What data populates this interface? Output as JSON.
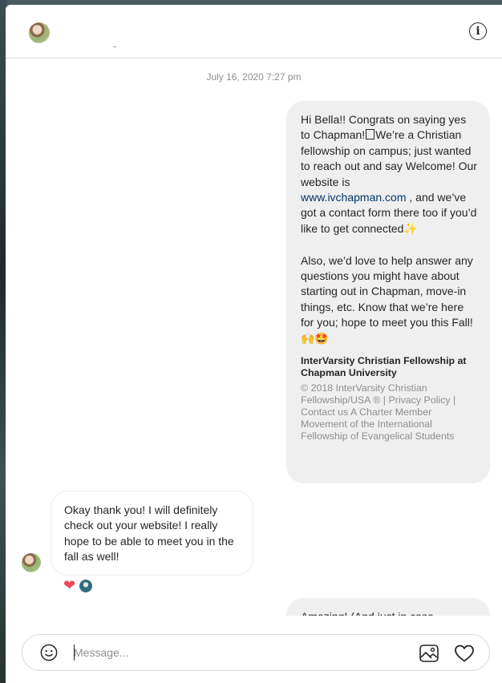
{
  "header": {
    "contact_avatar": "contact-avatar",
    "info_icon": "i"
  },
  "thread": {
    "timestamp": "July 16, 2020 7:27 pm",
    "outgoing_message": {
      "line1_pre": "Hi Bella!! Congrats on saying yes to Chapman!",
      "line1_post": "We’re a Christian fellowship on campus; just wanted to reach out and say Welcome! Our website is",
      "link": "www.ivchapman.com",
      "after_link": " , and we’ve got a contact form there too if you’d like to get connected",
      "sparkle": "✨",
      "paragraph2": "Also, we’d love to help answer any questions you might have about starting out in Chapman, move-in things, etc. Know that we’re here for you; hope to meet you this Fall!",
      "emojis": "🙌🤩",
      "preview_title": "InterVarsity Christian Fellowship at Chapman University",
      "preview_description": "© 2018 InterVarsity Christian Fellowship/USA ® | Privacy Policy | Contact us A Charter Member Movement of the International Fellowship of Evangelical Students"
    },
    "incoming_message": {
      "text": "Okay thank you! I will definitely check out your website! I really hope to be able to meet you in the fall as well!",
      "reaction": "❤"
    },
    "partial_message": {
      "text": "Amazing! (And just in case"
    }
  },
  "composer": {
    "placeholder": "Message...",
    "emoji_icon": "smiley-icon",
    "image_icon": "image-icon",
    "like_icon": "heart-icon"
  }
}
